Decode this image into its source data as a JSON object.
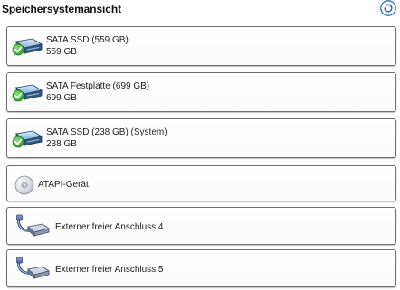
{
  "header": {
    "title": "Speichersystemansicht",
    "refresh_icon": "refresh-icon"
  },
  "devices": [
    {
      "name": "SATA SSD (559 GB)",
      "size": "559 GB",
      "icon": "disk-ok-icon",
      "status": "ok"
    },
    {
      "name": "SATA Festplatte (699 GB)",
      "size": "699 GB",
      "icon": "disk-ok-icon",
      "status": "ok"
    },
    {
      "name": "SATA SSD (238 GB) (System)",
      "size": "238 GB",
      "icon": "disk-ok-icon",
      "status": "ok"
    },
    {
      "name": "ATAPI-Gerät",
      "icon": "cd-icon"
    },
    {
      "name": "Externer freier Anschluss 4",
      "icon": "external-port-icon"
    },
    {
      "name": "Externer freier Anschluss 5",
      "icon": "external-port-icon"
    }
  ],
  "colors": {
    "accent": "#2f6fc0",
    "status_ok": "#3bb24a",
    "border": "#6e6e6e"
  }
}
